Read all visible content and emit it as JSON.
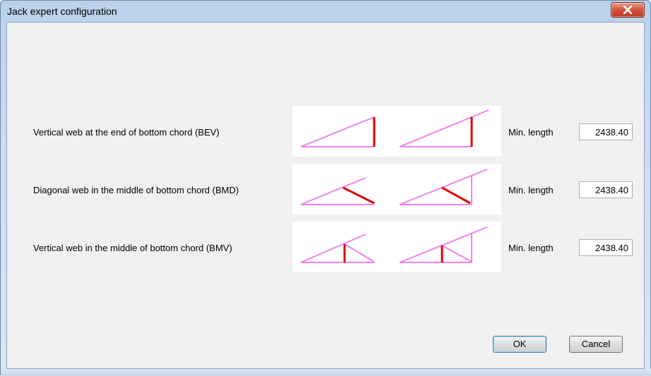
{
  "window": {
    "title": "Jack expert configuration",
    "close_icon": "close-icon"
  },
  "rows": [
    {
      "label": "Vertical web at the end of bottom chord (BEV)",
      "min_label": "Min. length",
      "value": "2438.40"
    },
    {
      "label": "Diagonal web in the middle of bottom chord (BMD)",
      "min_label": "Min. length",
      "value": "2438.40"
    },
    {
      "label": "Vertical web in the middle of bottom chord (BMV)",
      "min_label": "Min. length",
      "value": "2438.40"
    }
  ],
  "buttons": {
    "ok": "OK",
    "cancel": "Cancel"
  },
  "colors": {
    "chord": "#ee82ee",
    "web": "#e00000",
    "close": "#c8462f"
  }
}
